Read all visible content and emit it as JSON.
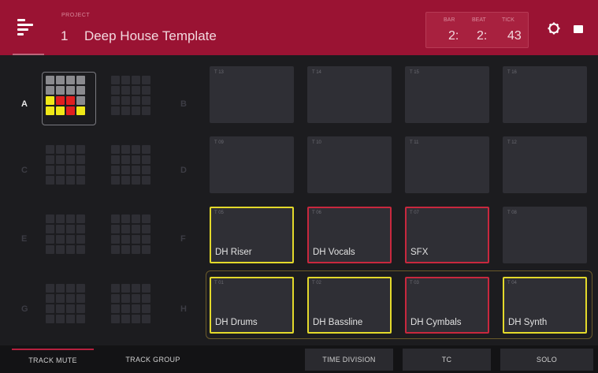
{
  "header": {
    "project_label": "PROJECT",
    "project_number": "1",
    "project_name": "Deep House Template",
    "position": {
      "bar_label": "BAR",
      "beat_label": "BEAT",
      "tick_label": "TICK",
      "bar": "2:",
      "beat": "2:",
      "tick": "43"
    },
    "icons": [
      "menu-icon",
      "gear-icon",
      "toggle-icon"
    ],
    "accent_color": "#9a1333"
  },
  "banks": [
    {
      "letter": "A",
      "active": true
    },
    {
      "letter": "B",
      "active": false
    },
    {
      "letter": "C",
      "active": false
    },
    {
      "letter": "D",
      "active": false
    },
    {
      "letter": "E",
      "active": false
    },
    {
      "letter": "F",
      "active": false
    },
    {
      "letter": "G",
      "active": false
    },
    {
      "letter": "H",
      "active": false
    }
  ],
  "pads": [
    {
      "num": "T 13",
      "name": "",
      "state": "empty"
    },
    {
      "num": "T 14",
      "name": "",
      "state": "empty"
    },
    {
      "num": "T 15",
      "name": "",
      "state": "empty"
    },
    {
      "num": "T 16",
      "name": "",
      "state": "empty"
    },
    {
      "num": "T 09",
      "name": "",
      "state": "empty"
    },
    {
      "num": "T 10",
      "name": "",
      "state": "empty"
    },
    {
      "num": "T 11",
      "name": "",
      "state": "empty"
    },
    {
      "num": "T 12",
      "name": "",
      "state": "empty"
    },
    {
      "num": "T 05",
      "name": "DH Riser",
      "state": "yellow"
    },
    {
      "num": "T 06",
      "name": "DH Vocals",
      "state": "red"
    },
    {
      "num": "T 07",
      "name": "SFX",
      "state": "red"
    },
    {
      "num": "T 08",
      "name": "",
      "state": "empty"
    },
    {
      "num": "T 01",
      "name": "DH Drums",
      "state": "yellow"
    },
    {
      "num": "T 02",
      "name": "DH Bassline",
      "state": "yellow"
    },
    {
      "num": "T 03",
      "name": "DH Cymbals",
      "state": "red"
    },
    {
      "num": "T 04",
      "name": "DH Synth",
      "state": "yellow"
    }
  ],
  "status_colors": {
    "unmuted": "#e3d92b",
    "muted": "#c8283e"
  },
  "bottom_tabs": [
    {
      "label": "TRACK MUTE",
      "selected": true
    },
    {
      "label": "TRACK GROUP",
      "selected": false
    },
    {
      "label": "TIME DIVISION",
      "selected": false
    },
    {
      "label": "TC",
      "selected": false
    },
    {
      "label": "SOLO",
      "selected": false
    }
  ]
}
